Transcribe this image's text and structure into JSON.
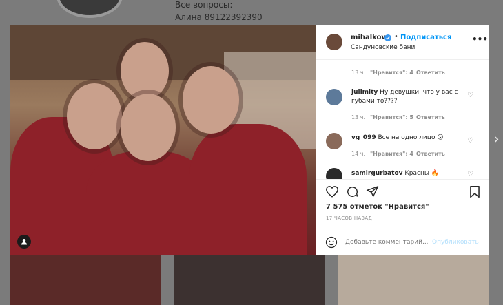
{
  "background": {
    "line1": "Все вопросы:",
    "line2": "Алина 89122392390"
  },
  "post": {
    "author": "mihalkova",
    "follow_label": "Подписаться",
    "location": "Сандуновские бани",
    "likes_text": "7 575 отметок \"Нравится\"",
    "time_ago": "17 ЧАСОВ НАЗАД",
    "comment_placeholder": "Добавьте комментарий...",
    "publish_label": "Опубликовать",
    "comments": [
      {
        "user": "",
        "text": "",
        "meta_time": "13 ч.",
        "meta_likes": "\"Нравится\": 4",
        "meta_reply": "Ответить"
      },
      {
        "user": "julimity",
        "text": "Ну девушки, что у вас с губами то????",
        "meta_time": "13 ч.",
        "meta_likes": "\"Нравится\": 5",
        "meta_reply": "Ответить"
      },
      {
        "user": "vg_099",
        "text": "Все на одно лицо 😮",
        "meta_time": "14 ч.",
        "meta_likes": "\"Нравится\": 4",
        "meta_reply": "Ответить"
      },
      {
        "user": "samirgurbatov",
        "text": "Красны 🔥",
        "meta_time": "",
        "meta_likes": "",
        "meta_reply": ""
      }
    ]
  },
  "colors": {
    "accent": "#0095f6",
    "text": "#262626",
    "muted": "#8e8e8e"
  }
}
